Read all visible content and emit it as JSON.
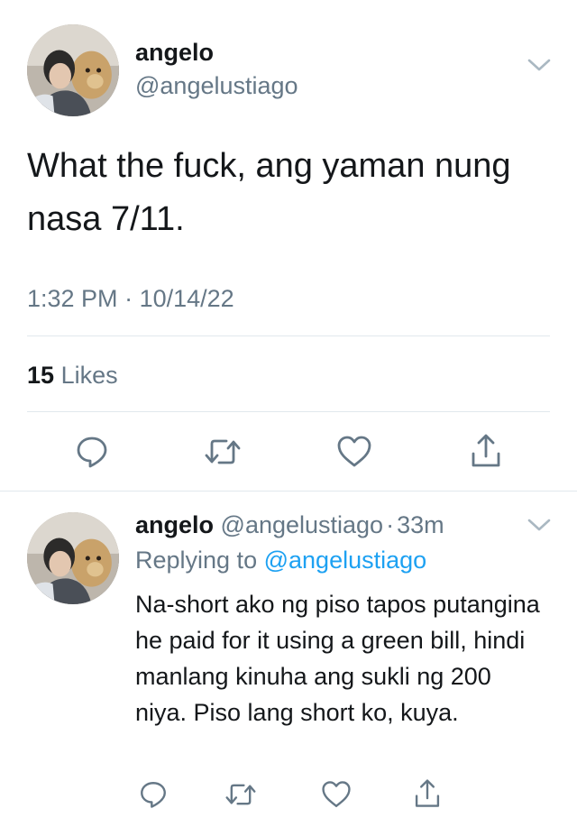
{
  "main_tweet": {
    "name": "angelo",
    "handle": "@angelustiago",
    "text": "What the fuck, ang yaman nung nasa 7/11.",
    "time": "1:32 PM",
    "separator": "·",
    "date": "10/14/22",
    "likes_count": "15",
    "likes_label": "Likes",
    "icons": [
      "reply-icon",
      "retweet-icon",
      "like-icon",
      "share-icon"
    ]
  },
  "reply_tweet": {
    "name": "angelo",
    "handle": "@angelustiago",
    "dot": "·",
    "age": "33m",
    "replying_prefix": "Replying to",
    "replying_handle": "@angelustiago",
    "text": "Na-short ako ng piso tapos putangina he paid for it using a green bill, hindi manlang kinuha ang sukli ng 200 niya. Piso lang short ko, kuya.",
    "icons": [
      "reply-icon",
      "retweet-icon",
      "like-icon",
      "share-icon"
    ]
  },
  "colors": {
    "text": "#14171a",
    "muted": "#657786",
    "link": "#1da1f2",
    "divider": "#e1e8ed"
  }
}
